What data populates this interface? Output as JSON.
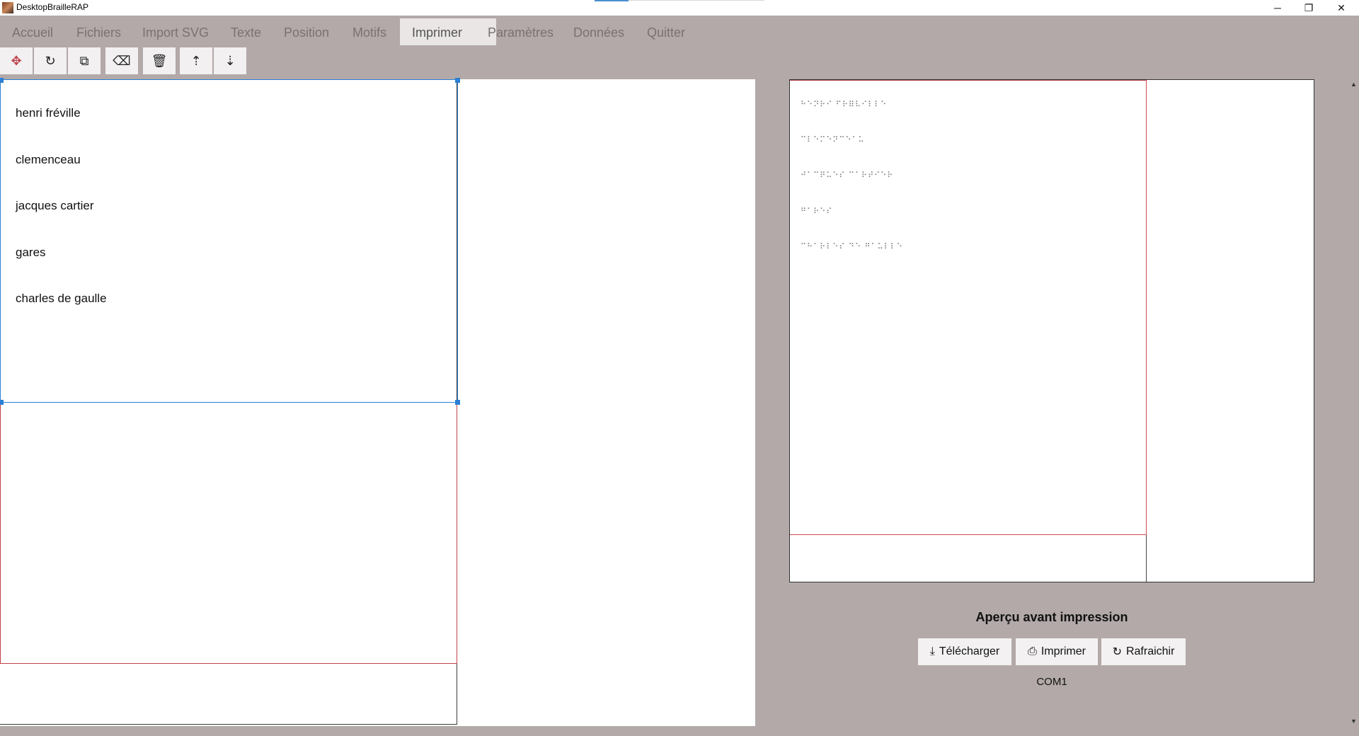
{
  "window": {
    "title": "DesktopBrailleRAP",
    "minimize": "─",
    "maximize": "❐",
    "close": "✕"
  },
  "menu": {
    "items": [
      "Accueil",
      "Fichiers",
      "Import SVG",
      "Texte",
      "Position",
      "Motifs",
      "Imprimer",
      "Paramètres",
      "Données",
      "Quitter"
    ],
    "active": "Imprimer"
  },
  "toolbar": {
    "buttons": [
      "move-icon",
      "rotate-icon",
      "external-link-icon",
      "eraser-icon",
      "trash-icon",
      "sort-ascending-icon",
      "sort-descending-icon"
    ]
  },
  "editor": {
    "lines": [
      "henri fréville",
      "clemenceau",
      "jacques cartier",
      "gares",
      "charles de gaulle"
    ]
  },
  "preview": {
    "braille_lines": [
      "⠓⠑⠝⠗⠊ ⠋⠗⠿⠧⠊⠇⠇⠑",
      "⠉⠇⠑⠍⠑⠝⠉⠑⠁⠥",
      "⠚⠁⠉⠟⠥⠑⠎ ⠉⠁⠗⠞⠊⠑⠗",
      "⠛⠁⠗⠑⠎",
      "⠉⠓⠁⠗⠇⠑⠎ ⠙⠑ ⠛⠁⠥⠇⠇⠑"
    ],
    "title": "Aperçu avant impression",
    "download_label": "Télécharger",
    "print_label": "Imprimer",
    "refresh_label": "Rafraichir",
    "port": "COM1"
  },
  "colors": {
    "background": "#b2a9a8",
    "selection": "#2b7fd4",
    "print_area": "#c0404a"
  }
}
